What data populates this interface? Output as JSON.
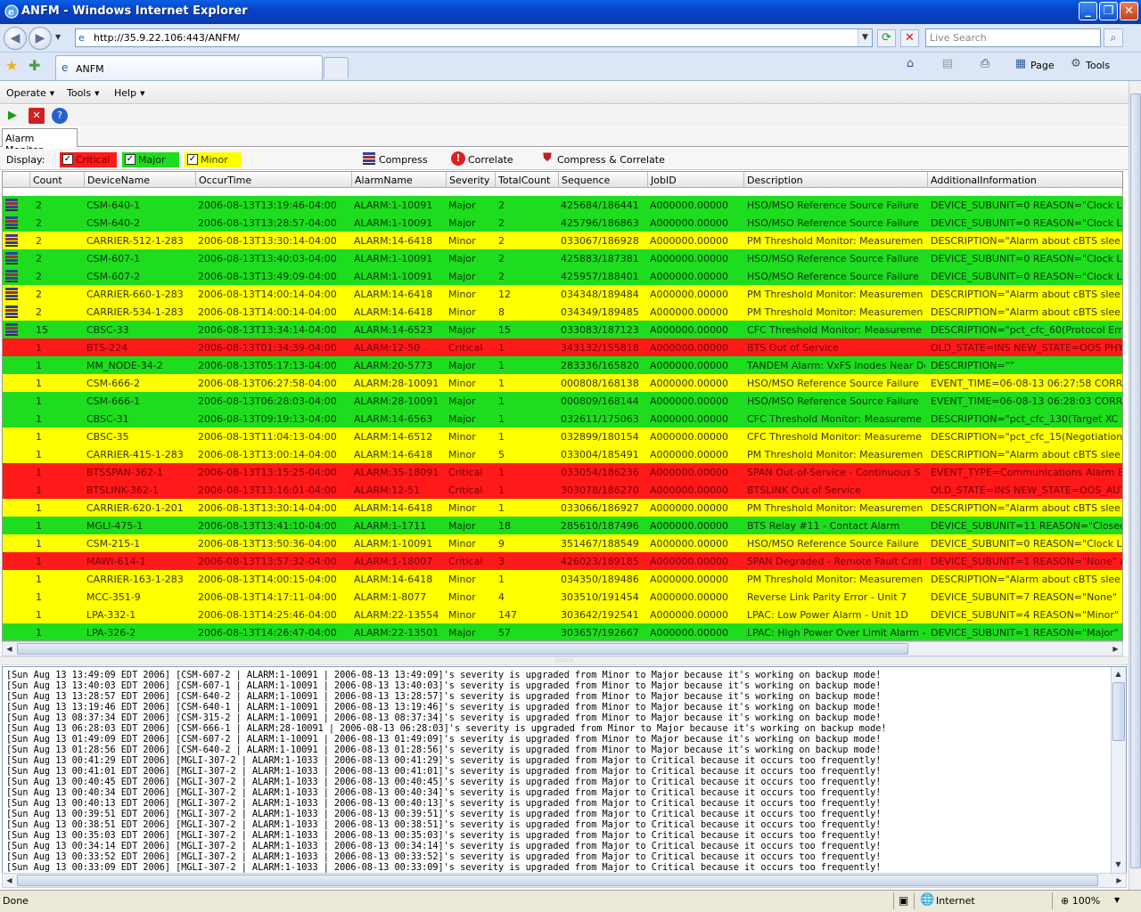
{
  "window": {
    "title": "ANFM - Windows Internet Explorer"
  },
  "browser": {
    "url": "http://35.9.22.106:443/ANFM/",
    "search_placeholder": "Live Search",
    "tab_label": "ANFM",
    "cmd_page": "Page",
    "cmd_tools": "Tools"
  },
  "app": {
    "menus": [
      "Operate",
      "Tools",
      "Help"
    ],
    "tab_alarm_monitor": "Alarm Monitor",
    "display_label": "Display:",
    "filters": [
      {
        "label": "Critical",
        "color": "#ff1a1a"
      },
      {
        "label": "Major",
        "color": "#1edc1e"
      },
      {
        "label": "Minor",
        "color": "#ffff00"
      }
    ],
    "actions": {
      "compress": "Compress",
      "correlate": "Correlate",
      "compress_correlate": "Compress & Correlate"
    },
    "columns": [
      "Count",
      "DeviceName",
      "OccurTime",
      "AlarmName",
      "Severity",
      "TotalCount",
      "Sequence",
      "JobID",
      "Description",
      "AdditionalInformation"
    ],
    "rows": [
      [
        "2",
        "CSM-640-1",
        "2006-08-13T13:19:46-04:00",
        "ALARM:1-10091",
        "Major",
        "2",
        "425684/186441",
        "A000000.00000",
        "HSO/MSO Reference Source Failure",
        "DEVICE_SUBUNIT=0 REASON=\"Clock Lo"
      ],
      [
        "2",
        "CSM-640-2",
        "2006-08-13T13:28:57-04:00",
        "ALARM:1-10091",
        "Major",
        "2",
        "425796/186863",
        "A000000.00000",
        "HSO/MSO Reference Source Failure",
        "DEVICE_SUBUNIT=0 REASON=\"Clock Lo"
      ],
      [
        "2",
        "CARRIER-512-1-283",
        "2006-08-13T13:30:14-04:00",
        "ALARM:14-6418",
        "Minor",
        "2",
        "033067/186928",
        "A000000.00000",
        "PM Threshold Monitor: Measuremen",
        "DESCRIPTION=\"Alarm about cBTS slee"
      ],
      [
        "2",
        "CSM-607-1",
        "2006-08-13T13:40:03-04:00",
        "ALARM:1-10091",
        "Major",
        "2",
        "425883/187381",
        "A000000.00000",
        "HSO/MSO Reference Source Failure",
        "DEVICE_SUBUNIT=0 REASON=\"Clock Lo"
      ],
      [
        "2",
        "CSM-607-2",
        "2006-08-13T13:49:09-04:00",
        "ALARM:1-10091",
        "Major",
        "2",
        "425957/188401",
        "A000000.00000",
        "HSO/MSO Reference Source Failure",
        "DEVICE_SUBUNIT=0 REASON=\"Clock Lo"
      ],
      [
        "2",
        "CARRIER-660-1-283",
        "2006-08-13T14:00:14-04:00",
        "ALARM:14-6418",
        "Minor",
        "12",
        "034348/189484",
        "A000000.00000",
        "PM Threshold Monitor: Measuremen",
        "DESCRIPTION=\"Alarm about cBTS slee"
      ],
      [
        "2",
        "CARRIER-534-1-283",
        "2006-08-13T14:00:14-04:00",
        "ALARM:14-6418",
        "Minor",
        "8",
        "034349/189485",
        "A000000.00000",
        "PM Threshold Monitor: Measuremen",
        "DESCRIPTION=\"Alarm about cBTS slee"
      ],
      [
        "15",
        "CBSC-33",
        "2006-08-13T13:34:14-04:00",
        "ALARM:14-6523",
        "Major",
        "15",
        "033083/187123",
        "A000000.00000",
        "CFC Threshold Monitor: Measureme",
        "DESCRIPTION=\"pct_cfc_60(Protocol Erro"
      ],
      [
        "1",
        "BTS-224",
        "2006-08-13T01:34:39-04:00",
        "ALARM:12-50",
        "Critical",
        "1",
        "343132/155818",
        "A000000.00000",
        "BTS Out of Service",
        "OLD_STATE=INS NEW_STATE=OOS PHY"
      ],
      [
        "1",
        "MM_NODE-34-2",
        "2006-08-13T05:17:13-04:00",
        "ALARM:20-5773",
        "Major",
        "1",
        "283336/165820",
        "A000000.00000",
        "TANDEM Alarm: VxFS Inodes Near De",
        "DESCRIPTION=\"\""
      ],
      [
        "1",
        "CSM-666-2",
        "2006-08-13T06:27:58-04:00",
        "ALARM:28-10091",
        "Minor",
        "1",
        "000808/168138",
        "A000000.00000",
        "HSO/MSO Reference Source Failure",
        "EVENT_TIME=06-08-13 06:27:58 CORR"
      ],
      [
        "1",
        "CSM-666-1",
        "2006-08-13T06:28:03-04:00",
        "ALARM:28-10091",
        "Major",
        "1",
        "000809/168144",
        "A000000.00000",
        "HSO/MSO Reference Source Failure",
        "EVENT_TIME=06-08-13 06:28:03 CORR"
      ],
      [
        "1",
        "CBSC-31",
        "2006-08-13T09:19:13-04:00",
        "ALARM:14-6563",
        "Major",
        "1",
        "032611/175063",
        "A000000.00000",
        "CFC Threshold Monitor: Measureme",
        "DESCRIPTION=\"pct_cfc_130(Target XC"
      ],
      [
        "1",
        "CBSC-35",
        "2006-08-13T11:04:13-04:00",
        "ALARM:14-6512",
        "Minor",
        "1",
        "032899/180154",
        "A000000.00000",
        "CFC Threshold Monitor: Measureme",
        "DESCRIPTION=\"pct_cfc_15(Negotiation"
      ],
      [
        "1",
        "CARRIER-415-1-283",
        "2006-08-13T13:00:14-04:00",
        "ALARM:14-6418",
        "Minor",
        "5",
        "033004/185491",
        "A000000.00000",
        "PM Threshold Monitor: Measuremen",
        "DESCRIPTION=\"Alarm about cBTS slee"
      ],
      [
        "1",
        "BTSSPAN-362-1",
        "2006-08-13T13:15:25-04:00",
        "ALARM:35-18091",
        "Critical",
        "1",
        "033054/186236",
        "A000000.00000",
        "SPAN Out-of-Service - Continuous S",
        "EVENT_TYPE=Communications Alarm EV"
      ],
      [
        "1",
        "BTSLINK-362-1",
        "2006-08-13T13:16:01-04:00",
        "ALARM:12-51",
        "Critical",
        "1",
        "303078/186270",
        "A000000.00000",
        "BTSLINK Out of Service",
        "OLD_STATE=INS NEW_STATE=OOS_AUT"
      ],
      [
        "1",
        "CARRIER-620-1-201",
        "2006-08-13T13:30:14-04:00",
        "ALARM:14-6418",
        "Minor",
        "1",
        "033066/186927",
        "A000000.00000",
        "PM Threshold Monitor: Measuremen",
        "DESCRIPTION=\"Alarm about cBTS slee"
      ],
      [
        "1",
        "MGLI-475-1",
        "2006-08-13T13:41:10-04:00",
        "ALARM:1-1711",
        "Major",
        "18",
        "285610/187496",
        "A000000.00000",
        "BTS Relay #11 - Contact Alarm",
        "DEVICE_SUBUNIT=11 REASON=\"Closed"
      ],
      [
        "1",
        "CSM-215-1",
        "2006-08-13T13:50:36-04:00",
        "ALARM:1-10091",
        "Minor",
        "9",
        "351467/188549",
        "A000000.00000",
        "HSO/MSO Reference Source Failure",
        "DEVICE_SUBUNIT=0 REASON=\"Clock Lo"
      ],
      [
        "1",
        "MAWI-614-1",
        "2006-08-13T13:57:32-04:00",
        "ALARM:1-18007",
        "Critical",
        "3",
        "426023/189185",
        "A000000.00000",
        "SPAN Degraded - Remote Fault Criti",
        "DEVICE_SUBUNIT=1 REASON=\"None\" A"
      ],
      [
        "1",
        "CARRIER-163-1-283",
        "2006-08-13T14:00:15-04:00",
        "ALARM:14-6418",
        "Minor",
        "1",
        "034350/189486",
        "A000000.00000",
        "PM Threshold Monitor: Measuremen",
        "DESCRIPTION=\"Alarm about cBTS slee"
      ],
      [
        "1",
        "MCC-351-9",
        "2006-08-13T14:17:11-04:00",
        "ALARM:1-8077",
        "Minor",
        "4",
        "303510/191454",
        "A000000.00000",
        "Reverse Link Parity Error - Unit 7",
        "DEVICE_SUBUNIT=7 REASON=\"None\""
      ],
      [
        "1",
        "LPA-332-1",
        "2006-08-13T14:25:46-04:00",
        "ALARM:22-13554",
        "Minor",
        "147",
        "303642/192541",
        "A000000.00000",
        "LPAC: Low Power Alarm - Unit 1D",
        "DEVICE_SUBUNIT=4 REASON=\"Minor\" I"
      ],
      [
        "1",
        "LPA-326-2",
        "2006-08-13T14:26:47-04:00",
        "ALARM:22-13501",
        "Major",
        "57",
        "303657/192667",
        "A000000.00000",
        "LPAC: High Power Over Limit Alarm -",
        "DEVICE_SUBUNIT=1 REASON=\"Major\" I"
      ]
    ],
    "compressed_row_count": 8,
    "log_lines": [
      "[Sun Aug 13 13:49:09 EDT 2006] [CSM-607-2 | ALARM:1-10091 | 2006-08-13 13:49:09]'s severity is upgraded from Minor to Major because it's working on backup mode!",
      "[Sun Aug 13 13:40:03 EDT 2006] [CSM-607-1 | ALARM:1-10091 | 2006-08-13 13:40:03]'s severity is upgraded from Minor to Major because it's working on backup mode!",
      "[Sun Aug 13 13:28:57 EDT 2006] [CSM-640-2 | ALARM:1-10091 | 2006-08-13 13:28:57]'s severity is upgraded from Minor to Major because it's working on backup mode!",
      "[Sun Aug 13 13:19:46 EDT 2006] [CSM-640-1 | ALARM:1-10091 | 2006-08-13 13:19:46]'s severity is upgraded from Minor to Major because it's working on backup mode!",
      "[Sun Aug 13 08:37:34 EDT 2006] [CSM-315-2 | ALARM:1-10091 | 2006-08-13 08:37:34]'s severity is upgraded from Minor to Major because it's working on backup mode!",
      "[Sun Aug 13 06:28:03 EDT 2006] [CSM-666-1 | ALARM:28-10091 | 2006-08-13 06:28:03]'s severity is upgraded from Minor to Major because it's working on backup mode!",
      "[Sun Aug 13 01:49:09 EDT 2006] [CSM-607-2 | ALARM:1-10091 | 2006-08-13 01:49:09]'s severity is upgraded from Minor to Major because it's working on backup mode!",
      "[Sun Aug 13 01:28:56 EDT 2006] [CSM-640-2 | ALARM:1-10091 | 2006-08-13 01:28:56]'s severity is upgraded from Minor to Major because it's working on backup mode!",
      "[Sun Aug 13 00:41:29 EDT 2006] [MGLI-307-2 | ALARM:1-1033 | 2006-08-13 00:41:29]'s severity is upgraded from Major to Critical because it occurs too frequently!",
      "[Sun Aug 13 00:41:01 EDT 2006] [MGLI-307-2 | ALARM:1-1033 | 2006-08-13 00:41:01]'s severity is upgraded from Major to Critical because it occurs too frequently!",
      "[Sun Aug 13 00:40:45 EDT 2006] [MGLI-307-2 | ALARM:1-1033 | 2006-08-13 00:40:45]'s severity is upgraded from Major to Critical because it occurs too frequently!",
      "[Sun Aug 13 00:40:34 EDT 2006] [MGLI-307-2 | ALARM:1-1033 | 2006-08-13 00:40:34]'s severity is upgraded from Major to Critical because it occurs too frequently!",
      "[Sun Aug 13 00:40:13 EDT 2006] [MGLI-307-2 | ALARM:1-1033 | 2006-08-13 00:40:13]'s severity is upgraded from Major to Critical because it occurs too frequently!",
      "[Sun Aug 13 00:39:51 EDT 2006] [MGLI-307-2 | ALARM:1-1033 | 2006-08-13 00:39:51]'s severity is upgraded from Major to Critical because it occurs too frequently!",
      "[Sun Aug 13 00:38:51 EDT 2006] [MGLI-307-2 | ALARM:1-1033 | 2006-08-13 00:38:51]'s severity is upgraded from Major to Critical because it occurs too frequently!",
      "[Sun Aug 13 00:35:03 EDT 2006] [MGLI-307-2 | ALARM:1-1033 | 2006-08-13 00:35:03]'s severity is upgraded from Major to Critical because it occurs too frequently!",
      "[Sun Aug 13 00:34:14 EDT 2006] [MGLI-307-2 | ALARM:1-1033 | 2006-08-13 00:34:14]'s severity is upgraded from Major to Critical because it occurs too frequently!",
      "[Sun Aug 13 00:33:52 EDT 2006] [MGLI-307-2 | ALARM:1-1033 | 2006-08-13 00:33:52]'s severity is upgraded from Major to Critical because it occurs too frequently!",
      "[Sun Aug 13 00:33:09 EDT 2006] [MGLI-307-2 | ALARM:1-1033 | 2006-08-13 00:33:09]'s severity is upgraded from Major to Critical because it occurs too frequently!"
    ]
  },
  "status": {
    "text": "Done",
    "zone": "Internet",
    "zoom": "100%"
  }
}
